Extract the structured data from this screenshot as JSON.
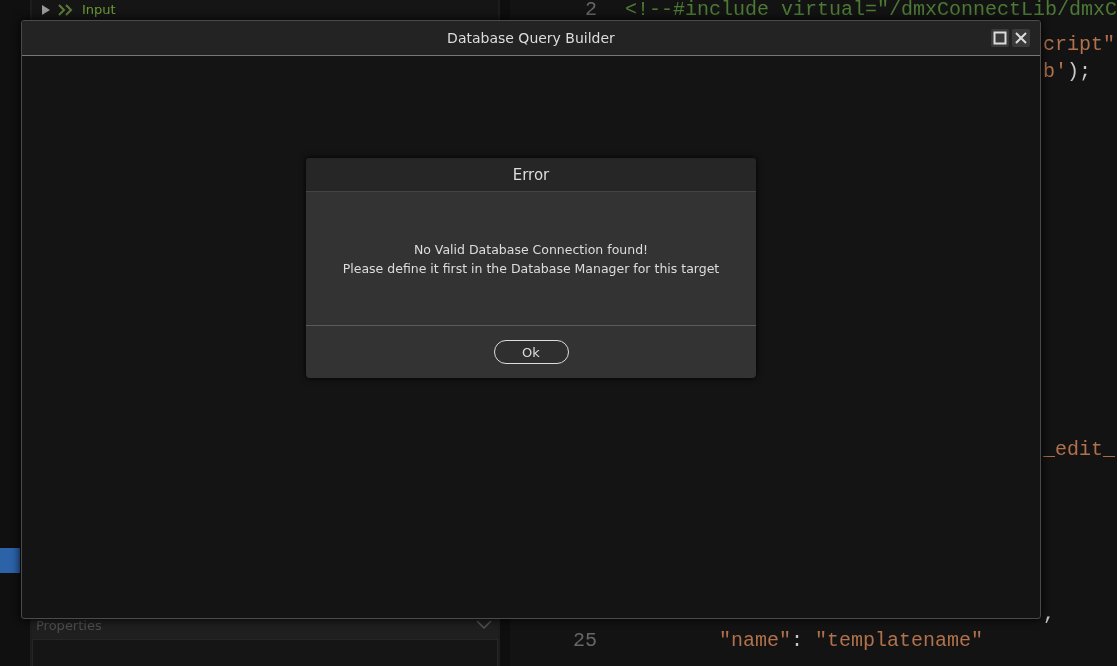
{
  "sidebar": {
    "tree_items": [
      {
        "label": "Input",
        "expanded": false
      }
    ],
    "properties_panel": {
      "title": "Properties"
    }
  },
  "editor": {
    "lines_top": [
      {
        "number": "2",
        "segments": [
          {
            "kind": "comment",
            "text": "<!--#include virtual=\"/dmxConnectLib/dmxC"
          }
        ]
      },
      {
        "kind": "tail",
        "segments": [
          {
            "kind": "string",
            "text": "cript\""
          }
        ]
      },
      {
        "kind": "tail",
        "segments": [
          {
            "kind": "string",
            "text": "b'"
          },
          {
            "kind": "punct",
            "text": ");"
          }
        ]
      }
    ],
    "lines_middle": [
      {
        "kind": "tail",
        "segments": [
          {
            "kind": "string",
            "text": "_edit_"
          }
        ]
      }
    ],
    "lines_bottom": [
      {
        "kind": "tail",
        "segments": [
          {
            "kind": "punct",
            "text": ","
          }
        ]
      },
      {
        "number": "25",
        "segments": [
          {
            "kind": "string",
            "text": "\"name\""
          },
          {
            "kind": "punct",
            "text": ": "
          },
          {
            "kind": "string",
            "text": "\"templatename\""
          }
        ]
      }
    ]
  },
  "window": {
    "title": "Database Query Builder"
  },
  "dialog": {
    "title": "Error",
    "message": [
      "No Valid Database Connection found!",
      "Please define it first in the Database Manager for this target"
    ],
    "buttons": [
      "Ok"
    ]
  }
}
